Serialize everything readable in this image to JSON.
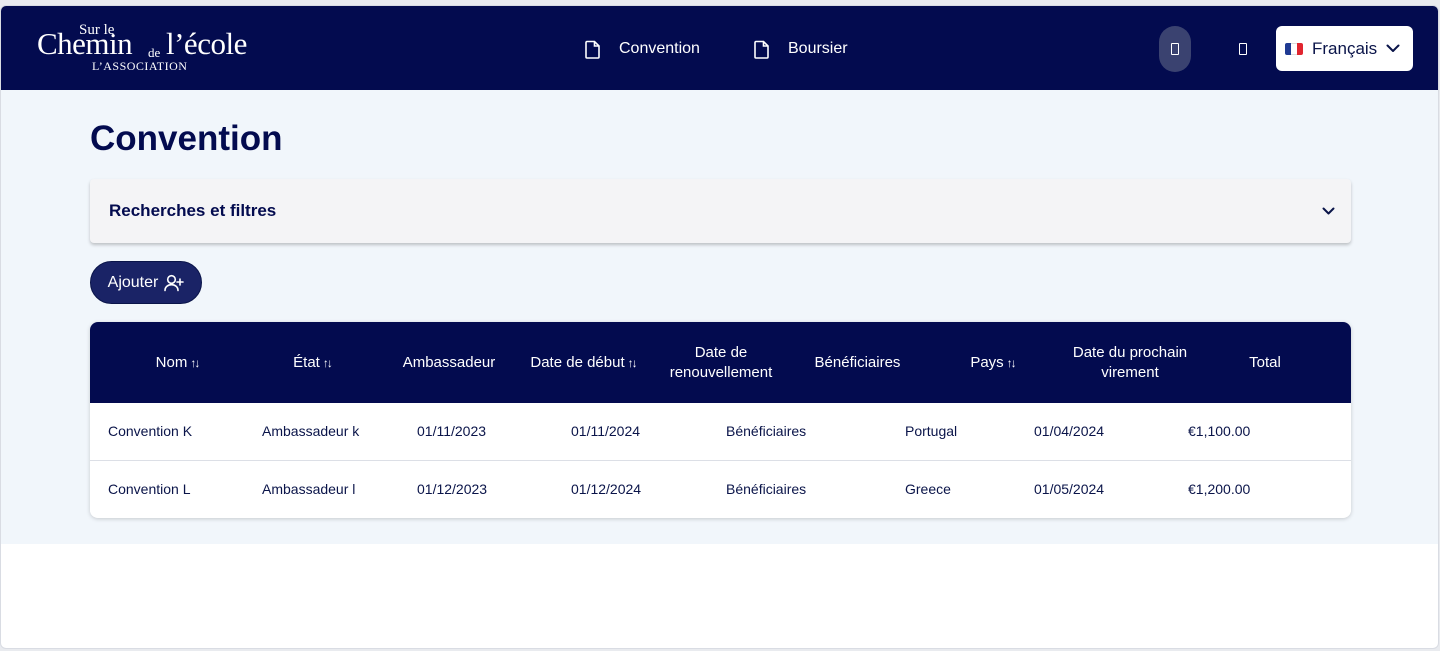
{
  "brand": {
    "line_sur": "Sur le",
    "line_chemin": "Chemin",
    "line_de": "de",
    "line_ecole": "l’école",
    "line_assoc": "L’ASSOCIATION"
  },
  "nav": {
    "links": [
      {
        "label": "Convention",
        "icon": "document-icon"
      },
      {
        "label": "Boursier",
        "icon": "document-icon"
      }
    ],
    "language": {
      "label": "Français",
      "flag_colors": [
        "#1f3a93",
        "#ffffff",
        "#e1252f"
      ]
    }
  },
  "colors": {
    "navy": "#030b4f",
    "page_bg": "#f1f6fb",
    "button": "#1a2366"
  },
  "page": {
    "title": "Convention",
    "filters_label": "Recherches et filtres",
    "add_label": "Ajouter"
  },
  "table": {
    "columns": [
      {
        "label": "Nom",
        "sortable": true
      },
      {
        "label": "État",
        "sortable": true
      },
      {
        "label": "Ambassadeur",
        "sortable": false
      },
      {
        "label": "Date de début",
        "sortable": true
      },
      {
        "label_line1": "Date de",
        "label_line2": "renouvellement",
        "sortable": false
      },
      {
        "label": "Bénéficiaires",
        "sortable": false
      },
      {
        "label": "Pays",
        "sortable": true
      },
      {
        "label_line1": "Date du prochain",
        "label_line2": "virement",
        "sortable": false
      },
      {
        "label": "Total",
        "sortable": false
      }
    ],
    "sort_glyph": "↑↓",
    "rows": [
      {
        "nom": "Convention K",
        "ambassadeur": "Ambassadeur k",
        "debut": "01/11/2023",
        "renouvellement": "01/11/2024",
        "beneficiaires": "Bénéficiaires",
        "pays": "Portugal",
        "virement": "01/04/2024",
        "total": "€1,100.00"
      },
      {
        "nom": "Convention L",
        "ambassadeur": "Ambassadeur l",
        "debut": "01/12/2023",
        "renouvellement": "01/12/2024",
        "beneficiaires": "Bénéficiaires",
        "pays": "Greece",
        "virement": "01/05/2024",
        "total": "€1,200.00"
      }
    ]
  }
}
